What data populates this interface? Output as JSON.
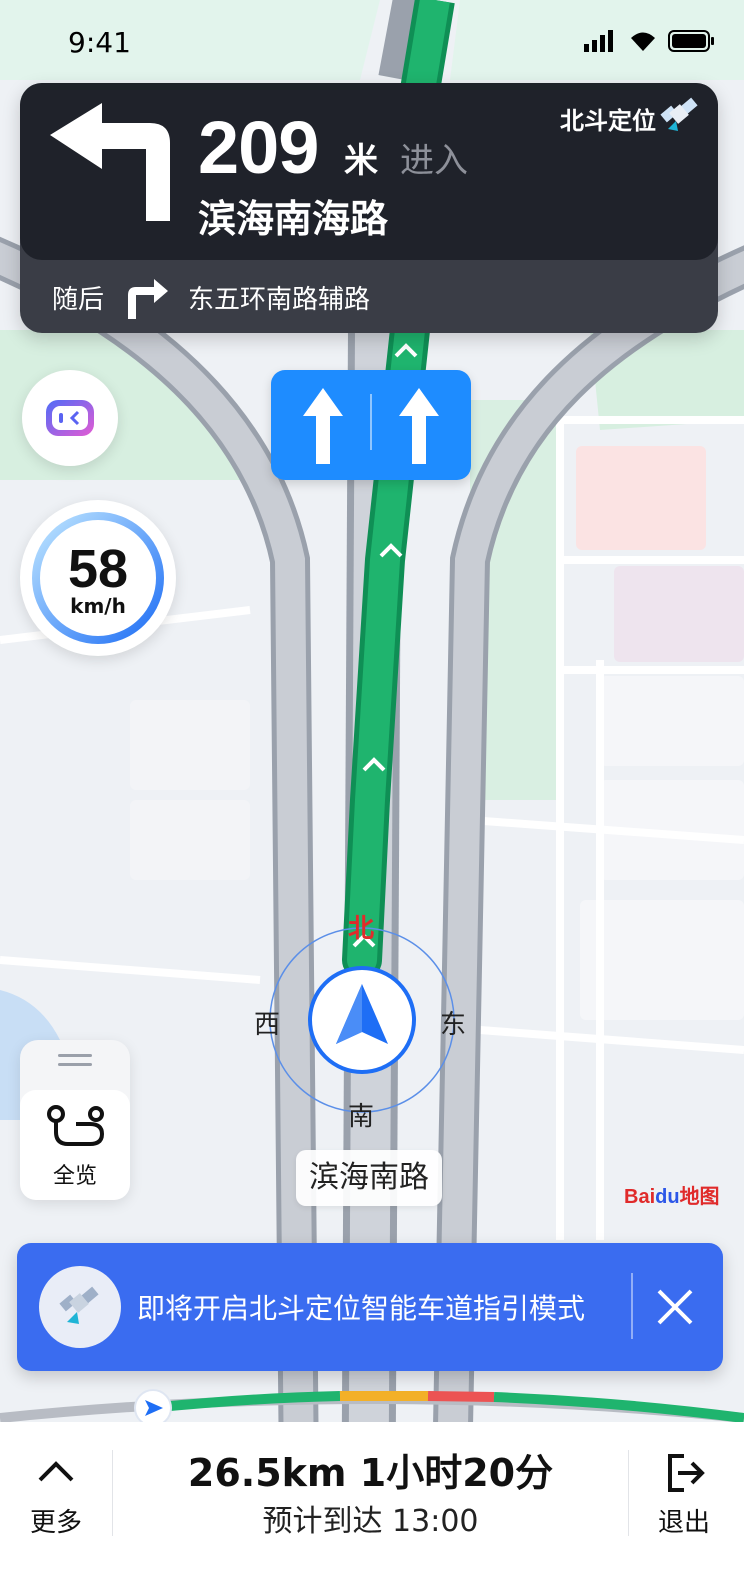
{
  "status_bar": {
    "time": "9:41"
  },
  "guidance": {
    "distance": "209",
    "distance_unit": "米",
    "action": "进入",
    "road": "滨海南海路",
    "positioning": "北斗定位",
    "next_label": "随后",
    "next_road": "东五环南路辅路"
  },
  "speed": {
    "value": "58",
    "unit": "km/h"
  },
  "compass": {
    "north": "北",
    "south": "南",
    "east": "东",
    "west": "西"
  },
  "current_road": "滨海南路",
  "overview": {
    "label": "全览"
  },
  "logo": {
    "text_a": "Bai",
    "text_b": "du",
    "text_c": "地图"
  },
  "notice": {
    "message": "即将开启北斗定位智能车道指引模式"
  },
  "bottom": {
    "more_label": "更多",
    "summary": "26.5km 1小时20分",
    "eta": "预计到达 13:00",
    "exit_label": "退出"
  },
  "colors": {
    "route": "#1fb46e",
    "accent": "#1e8cff",
    "banner": "#3a6cf0",
    "traffic_slow": "#f3b028",
    "traffic_jam": "#ec5353"
  }
}
